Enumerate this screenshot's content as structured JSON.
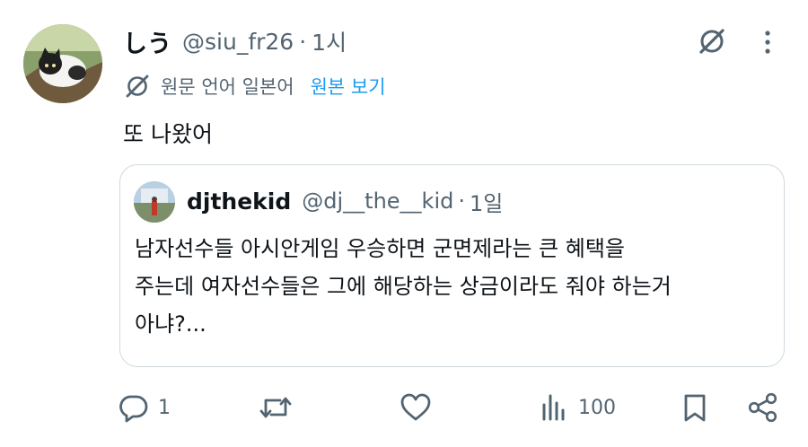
{
  "tweet": {
    "author": {
      "display_name": "しう",
      "handle": "@siu_fr26",
      "separator": "·",
      "time": "1시",
      "avatar_icon": "cat-photo-avatar"
    },
    "translation": {
      "original_language_label": "원문 언어 일본어",
      "show_original_label": "원본 보기"
    },
    "text": "또 나왔어",
    "quoted": {
      "display_name": "djthekid",
      "handle": "@dj__the__kid",
      "separator": "·",
      "time": "1일",
      "text_lines": [
        "남자선수들 아시안게임 우승하면 군면제라는 큰 혜택을",
        "주는데 여자선수들은 그에 해당하는 상금이라도 줘야 하는거",
        "아냐?..."
      ]
    },
    "actions": {
      "reply_count": "1",
      "retweet_count": "",
      "like_count": "",
      "view_count": "100"
    }
  },
  "colors": {
    "text_primary": "#0f1419",
    "text_secondary": "#536471",
    "link_blue": "#1d9bf0",
    "border": "#cfd9de"
  }
}
